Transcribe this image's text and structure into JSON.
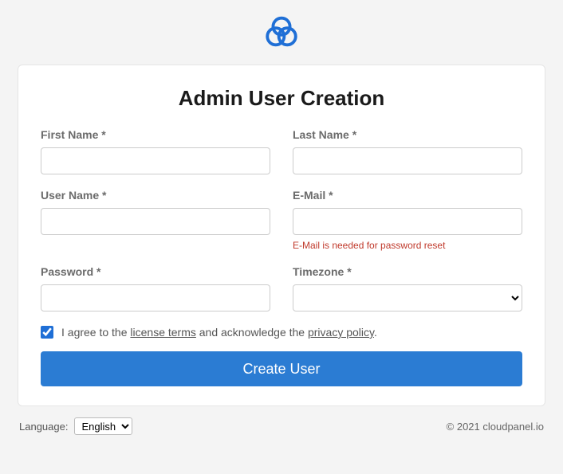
{
  "title": "Admin User Creation",
  "fields": {
    "firstName": {
      "label": "First Name *",
      "value": ""
    },
    "lastName": {
      "label": "Last Name *",
      "value": ""
    },
    "userName": {
      "label": "User Name *",
      "value": ""
    },
    "email": {
      "label": "E-Mail *",
      "value": "",
      "hint": "E-Mail is needed for password reset"
    },
    "password": {
      "label": "Password *",
      "value": ""
    },
    "timezone": {
      "label": "Timezone *",
      "value": ""
    }
  },
  "agree": {
    "checked": true,
    "prefix": "I agree to the ",
    "licenseLink": "license terms",
    "middle": " and acknowledge the ",
    "privacyLink": "privacy policy",
    "suffix": "."
  },
  "submitLabel": "Create User",
  "footer": {
    "languageLabel": "Language:",
    "languageValue": "English",
    "copyright": "© 2021  cloudpanel.io"
  }
}
